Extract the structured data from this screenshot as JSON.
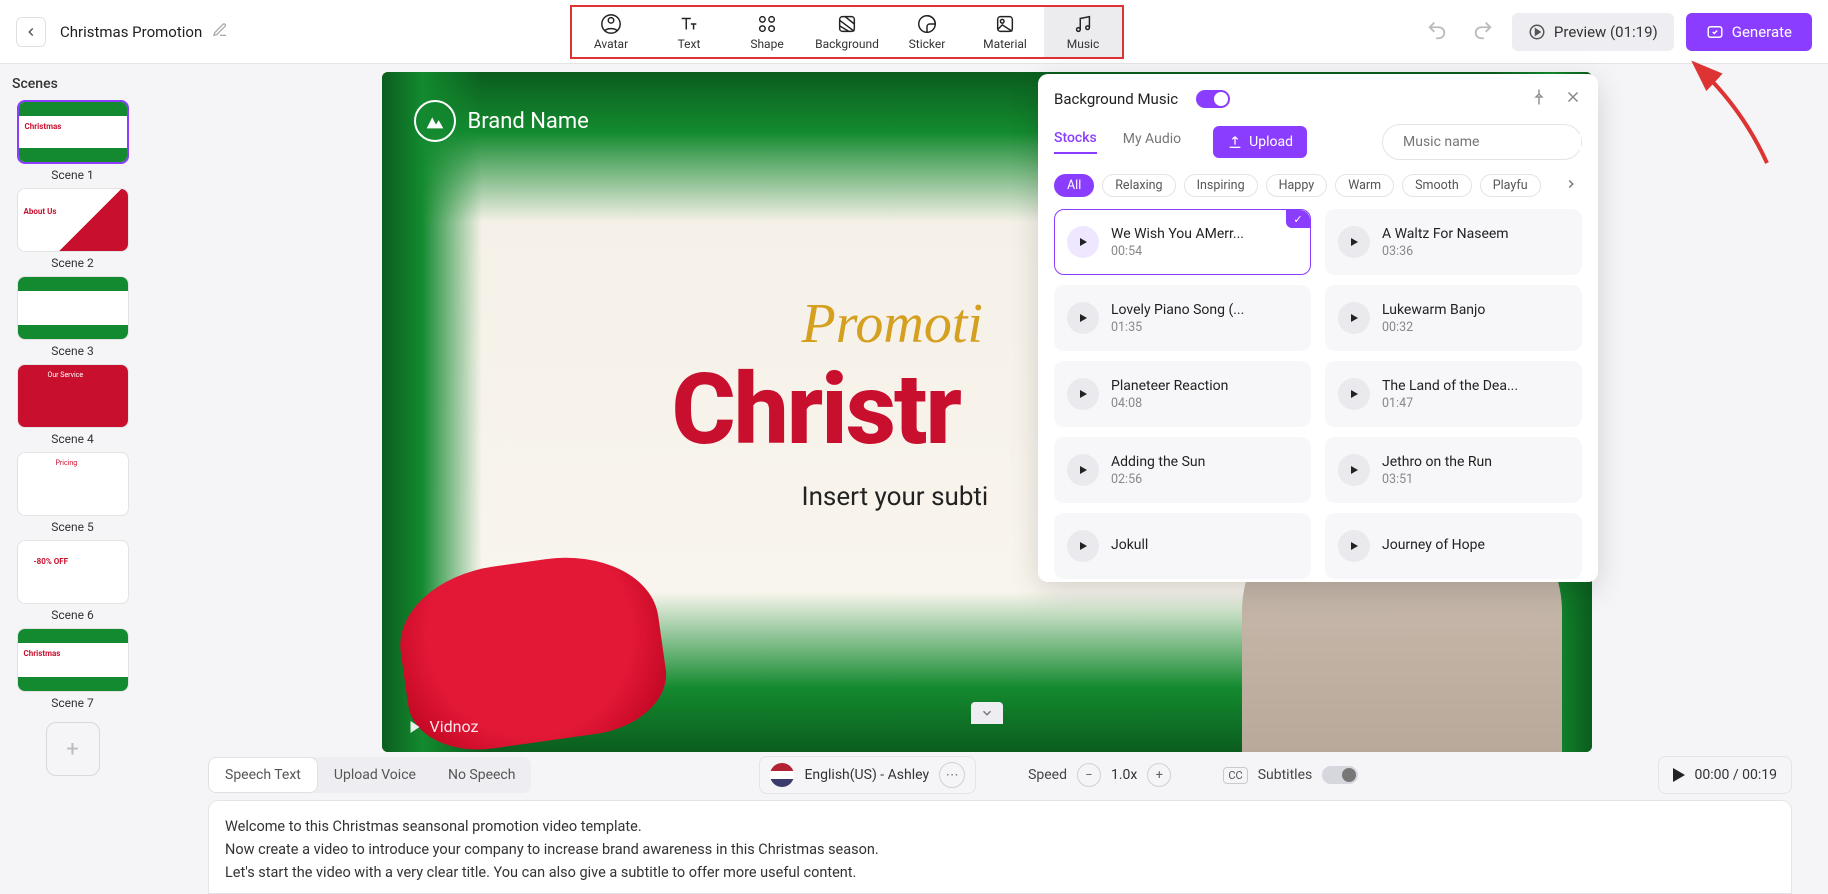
{
  "header": {
    "project_title": "Christmas Promotion",
    "preview_label": "Preview (01:19)",
    "generate_label": "Generate"
  },
  "tools": [
    {
      "label": "Avatar"
    },
    {
      "label": "Text"
    },
    {
      "label": "Shape"
    },
    {
      "label": "Background"
    },
    {
      "label": "Sticker"
    },
    {
      "label": "Material"
    },
    {
      "label": "Music"
    }
  ],
  "scenes": {
    "title": "Scenes",
    "items": [
      {
        "label": "Scene 1"
      },
      {
        "label": "Scene 2"
      },
      {
        "label": "Scene 3"
      },
      {
        "label": "Scene 4"
      },
      {
        "label": "Scene 5"
      },
      {
        "label": "Scene 6"
      },
      {
        "label": "Scene 7"
      }
    ]
  },
  "canvas": {
    "brand": "Brand Name",
    "promo": "Promoti",
    "main": "Christr",
    "subtitle": "Insert your subti",
    "watermark": "Vidnoz"
  },
  "music": {
    "title": "Background Music",
    "tabs": {
      "stocks": "Stocks",
      "my_audio": "My Audio"
    },
    "upload": "Upload",
    "search_placeholder": "Music name",
    "categories": [
      "All",
      "Relaxing",
      "Inspiring",
      "Happy",
      "Warm",
      "Smooth",
      "Playfu"
    ],
    "tracks": [
      {
        "name": "We Wish You AMerr...",
        "dur": "00:54",
        "selected": true
      },
      {
        "name": "A Waltz For Naseem",
        "dur": "03:36"
      },
      {
        "name": "Lovely Piano Song (...",
        "dur": "01:35"
      },
      {
        "name": "Lukewarm Banjo",
        "dur": "00:32"
      },
      {
        "name": "Planeteer Reaction",
        "dur": "04:08"
      },
      {
        "name": "The Land of the Dea...",
        "dur": "01:47"
      },
      {
        "name": "Adding the Sun",
        "dur": "02:56"
      },
      {
        "name": "Jethro on the Run",
        "dur": "03:51"
      },
      {
        "name": "Jokull",
        "dur": ""
      },
      {
        "name": "Journey of Hope",
        "dur": ""
      }
    ]
  },
  "bottom": {
    "speech_tabs": [
      "Speech Text",
      "Upload Voice",
      "No Speech"
    ],
    "language": "English(US) - Ashley",
    "speed_label": "Speed",
    "speed_value": "1.0x",
    "subtitles_label": "Subtitles",
    "play_time": "00:00 / 00:19"
  },
  "script": {
    "line1": "Welcome to this Christmas seansonal promotion video template.",
    "line2": "Now create a video to introduce your company to increase brand awareness in this Christmas season.",
    "line3": "Let's start the video with a very clear title. You can also give a subtitle to offer more useful content."
  }
}
